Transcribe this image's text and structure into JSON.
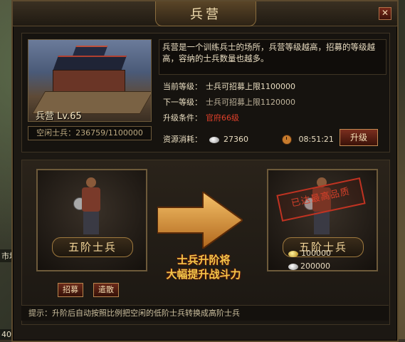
{
  "window": {
    "title": "兵营",
    "close_label": "✕"
  },
  "building": {
    "name": "兵营  Lv.65",
    "idle_soldiers": "空闲士兵：236759/1100000"
  },
  "info": {
    "description": "兵营是一个训练兵士的场所，兵营等级越高，招募的等级越高，容纳的士兵数量也越多。",
    "current_level_label": "当前等级：",
    "current_level_value": "士兵可招募上限1100000",
    "next_level_label": "下一等级：",
    "next_level_value": "士兵可招募上限1120000",
    "upgrade_condition_label": "升级条件：",
    "upgrade_condition_value": "官府66级",
    "resource_label": "资源消耗：",
    "resource_silver": "27360",
    "resource_time": "08:51:21",
    "upgrade_button": "升级"
  },
  "promotion": {
    "left_soldier_name": "五阶士兵",
    "right_soldier_name": "五阶士兵",
    "recruit_button": "招募",
    "dismiss_button": "遣散",
    "slogan_line1": "士兵升阶将",
    "slogan_line2": "大幅提升战斗力",
    "max_stamp": "已达最高品质",
    "gold_cost": "100000",
    "silver_cost": "200000"
  },
  "tip": "提示：升阶后自动按照比例把空闲的低阶士兵转换成高阶士兵",
  "background_labels": {
    "left_1": "市场",
    "left_2": "40"
  },
  "colors": {
    "accent_gold": "#f3c64a",
    "condition_red": "#e0402a"
  }
}
